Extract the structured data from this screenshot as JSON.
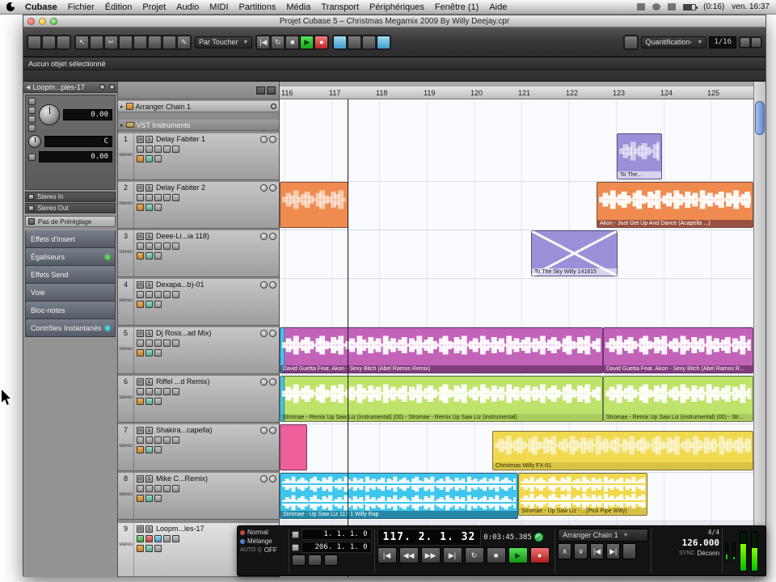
{
  "menubar": {
    "items": [
      "Cubase",
      "Fichier",
      "Édition",
      "Projet",
      "Audio",
      "MIDI",
      "Partitions",
      "Média",
      "Transport",
      "Périphériques",
      "Fenêtre (1)",
      "Aide"
    ],
    "battery_time": "(0:16)",
    "clock": "ven. 16:37"
  },
  "window": {
    "title": "Projet Cubase 5 – Christmas Megamix 2009 By Willy Deejay.cpr"
  },
  "toolbar": {
    "tool_mode": "Par Toucher",
    "quantize_label": "Quantification-",
    "quantize_value": "1/16"
  },
  "infoline": {
    "text": "Aucun objet sélectionné"
  },
  "inspector": {
    "track_name": "Loopm...ples-17",
    "volume": "0.00",
    "pan": "C",
    "delay": "0.00",
    "input": "Stereo In",
    "output": "Stereo Out",
    "preset": "Pas de Préréglage",
    "sections": [
      "Effets d'Insert",
      "Égaliseurs",
      "Effets Send",
      "Voie",
      "Bloc-notes",
      "Contrôles Instantanés"
    ]
  },
  "tracklist": {
    "arranger_name": "Arranger Chain 1",
    "folder_name": "VST Instruments",
    "stereo_label": "stereo",
    "mute": "m",
    "solo": "s",
    "tracks": [
      {
        "num": "1",
        "name": "Delay Fabiter 1"
      },
      {
        "num": "2",
        "name": "Delay Fabiter 2"
      },
      {
        "num": "3",
        "name": "Deee-Li...ia 118)"
      },
      {
        "num": "4",
        "name": "Dexapa...b)-01"
      },
      {
        "num": "5",
        "name": "Dj Ross...ad Mix)"
      },
      {
        "num": "6",
        "name": "Riffel ...d Remix)"
      },
      {
        "num": "7",
        "name": "Shakira...capella)"
      },
      {
        "num": "8",
        "name": "Mike C...Remix)"
      },
      {
        "num": "9",
        "name": "Loopm...les-17"
      }
    ]
  },
  "ruler": {
    "marks": [
      "116",
      "117",
      "118",
      "119",
      "120",
      "121",
      "122",
      "123",
      "124",
      "125"
    ]
  },
  "clips": {
    "t1_label": "To The...",
    "t2_label": "Akon - Just Get Up And Dance (Acapella ...)",
    "t3_label": "To The Sky Willy 141815",
    "t5a_label": "David Guetta Feat. Akon - Sexy Bitch (Abel Ramos Remix)",
    "t5b_label": "David Guetta Feat. Akon - Sexy Bitch (Abel Ramos R...",
    "t6a_label": "Stromae - Remix Up Saw Liz (instrumental) (00) - Stromae - Remix Up Saw Liz (instrumental)",
    "t6b_label": "Stromae - Remix Up Saw Liz (instrumental) (00) - Str...",
    "t7_label": "Christmas Willy FX-01",
    "t8a_label": "Stromae - Up Saw Liz 117 1 Willy Rap",
    "t8b_label": "Stromae - Up Saw Liz - ...(Pick Pipe Willy)"
  },
  "transport": {
    "rec_mode": "Normal",
    "cycle_mode": "Mélange",
    "autoq_label": "AUTO Q",
    "autoq_value": "OFF",
    "loc_left": "1. 1. 1.   0",
    "loc_right": "206. 1. 1.   0",
    "position": "117. 2. 1. 32",
    "time": "0:03:45.385",
    "arranger": "Arranger Chain 1",
    "timesig": "4/4",
    "tempo": "126.000",
    "sync_label": "SYNC",
    "sync_value": "Déconn"
  },
  "icons": {
    "to_start": "|◀",
    "rewind": "◀◀",
    "forward": "▶▶",
    "to_end": "▶|",
    "cycle": "↻",
    "stop": "■",
    "play": "▶",
    "record": "●",
    "dropdown": "▼",
    "pointer": "↖",
    "pencil": "✎",
    "scissors": "✂",
    "check": "✓",
    "collapse": "◀",
    "up": "∧",
    "down": "∨"
  },
  "colors": {
    "orange_clip": "#ef8b4e",
    "purple_clip": "#9b90d8",
    "magenta_clip": "#c263b8",
    "green_clip": "#bfe36a",
    "pink_clip": "#ef5f9a",
    "yellow_clip": "#f0d94f",
    "cyan_clip": "#3fc6ec",
    "play_green": "#2ecc40",
    "record_red": "#e03c3c"
  },
  "textures": {
    "waveform": "▂▅▃▇▂▄▆▃▁▅▇▃▂▆▄▇▁▃▅▂▇▄▂▆▃▅▁▇▃▅▂▄▆▁▅▃▇▂▄▆▃▁▅▇▃▂▆▄▇▁▃▅▂▇▄▂▆▃▅▁▇▃▅▂▄▆▂▅▃▇▂▄▆▃▁▅▇▃▂▆▄▇▁▃▅▂▇▄▂▆▃▅▁▇▄▆▂▅▃▇▂▄▆▃▁▅▇▃▂▆▄▇"
  }
}
